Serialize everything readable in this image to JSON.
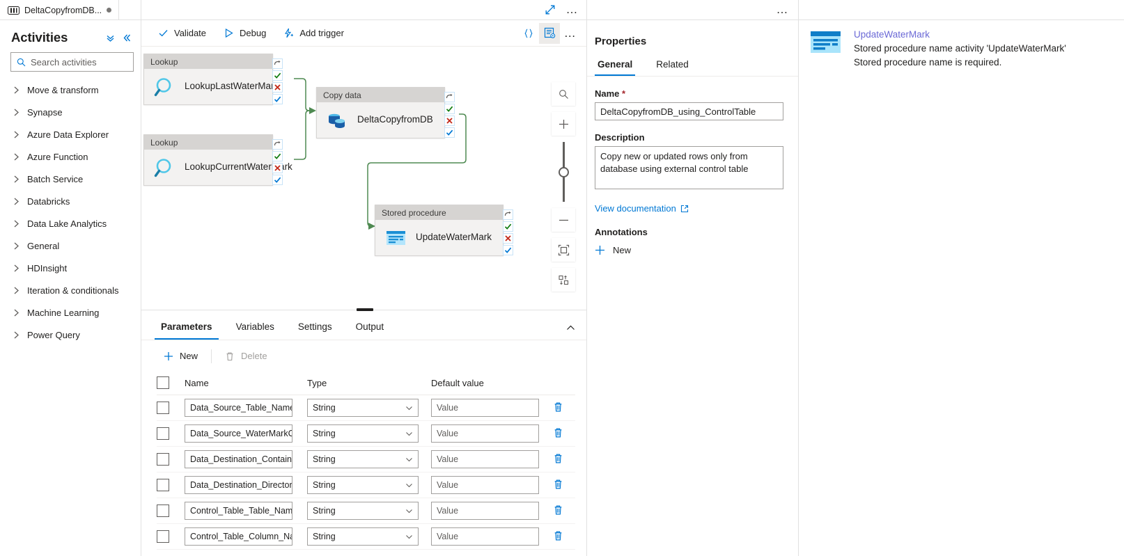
{
  "document_tab": {
    "title": "DeltaCopyfromDB...",
    "icon": "pipeline-icon",
    "dirty": true
  },
  "sidebar": {
    "title": "Activities",
    "collapse_all_icon": "double-chevron-down-icon",
    "collapse_pane_icon": "double-chevron-left-icon",
    "search": {
      "placeholder": "Search activities",
      "value": "",
      "icon": "search-icon"
    },
    "items": [
      {
        "label": "Move & transform"
      },
      {
        "label": "Synapse"
      },
      {
        "label": "Azure Data Explorer"
      },
      {
        "label": "Azure Function"
      },
      {
        "label": "Batch Service"
      },
      {
        "label": "Databricks"
      },
      {
        "label": "Data Lake Analytics"
      },
      {
        "label": "General"
      },
      {
        "label": "HDInsight"
      },
      {
        "label": "Iteration & conditionals"
      },
      {
        "label": "Machine Learning"
      },
      {
        "label": "Power Query"
      }
    ]
  },
  "canvas_header": {
    "expand_icon": "expand-diagonal-icon",
    "more_icon": "ellipsis-icon"
  },
  "toolbar": {
    "validate_label": "Validate",
    "debug_label": "Debug",
    "add_trigger_label": "Add trigger",
    "code_icon": "curly-braces-icon",
    "properties_icon": "properties-panel-icon",
    "more_icon": "ellipsis-icon"
  },
  "canvas": {
    "nodes": [
      {
        "type": "Lookup",
        "name": "LookupLastWaterMark",
        "icon": "magnifier-icon"
      },
      {
        "type": "Lookup",
        "name": "LookupCurrentWaterMark",
        "icon": "magnifier-icon"
      },
      {
        "type": "Copy data",
        "name": "DeltaCopyfromDB",
        "icon": "database-copy-icon"
      },
      {
        "type": "Stored procedure",
        "name": "UpdateWaterMark",
        "icon": "stored-procedure-icon"
      }
    ],
    "port_labels": [
      "on skip",
      "on success",
      "on failure",
      "on completion"
    ],
    "zoom_controls": [
      {
        "name": "search-canvas",
        "icon": "magnifier-icon"
      },
      {
        "name": "zoom-in",
        "icon": "plus-icon"
      },
      {
        "name": "zoom-slider",
        "icon": "slider"
      },
      {
        "name": "zoom-out",
        "icon": "minus-icon"
      },
      {
        "name": "zoom-to-fit",
        "icon": "fit-to-screen-icon"
      },
      {
        "name": "auto-align",
        "icon": "auto-align-icon"
      }
    ]
  },
  "dock": {
    "tabs": [
      {
        "label": "Parameters",
        "active": true
      },
      {
        "label": "Variables",
        "active": false
      },
      {
        "label": "Settings",
        "active": false
      },
      {
        "label": "Output",
        "active": false
      }
    ],
    "collapse_icon": "chevron-up-icon",
    "commands": {
      "new_label": "New",
      "new_icon": "plus-icon",
      "delete_label": "Delete",
      "delete_icon": "trash-icon",
      "delete_disabled": true
    },
    "table": {
      "headers": [
        "Name",
        "Type",
        "Default value"
      ],
      "default_value_placeholder": "Value",
      "delete_row_icon": "trash-icon",
      "rows": [
        {
          "name": "Data_Source_Table_Name",
          "type": "String",
          "default": ""
        },
        {
          "name": "Data_Source_WaterMarkColumn",
          "type": "String",
          "default": ""
        },
        {
          "name": "Data_Destination_Container",
          "type": "String",
          "default": ""
        },
        {
          "name": "Data_Destination_Directory",
          "type": "String",
          "default": ""
        },
        {
          "name": "Control_Table_Table_Name",
          "type": "String",
          "default": ""
        },
        {
          "name": "Control_Table_Column_Name",
          "type": "String",
          "default": ""
        }
      ]
    }
  },
  "properties": {
    "heading": "Properties",
    "more_icon": "ellipsis-icon",
    "tabs": [
      {
        "label": "General",
        "active": true
      },
      {
        "label": "Related",
        "active": false
      }
    ],
    "name_label": "Name",
    "name_required_mark": "*",
    "name_value": "DeltaCopyfromDB_using_ControlTable",
    "description_label": "Description",
    "description_value": "Copy new or updated rows only from database using external control table",
    "doc_link_label": "View documentation",
    "doc_link_icon": "external-link-icon",
    "annotations_label": "Annotations",
    "annotation_new_label": "New",
    "annotation_new_icon": "plus-icon"
  },
  "validation": {
    "item_title": "UpdateWaterMark",
    "item_icon": "stored-procedure-icon",
    "message_line1": "Stored procedure name activity 'UpdateWaterMark'",
    "message_line2": "Stored procedure name is required."
  },
  "colors": {
    "accent": "#0078d4",
    "link_purple": "#6b69d6",
    "success_green": "#107c10",
    "failure_red": "#c42b1c",
    "connector_green": "#4f8a52",
    "node_header": "#d6d4d2",
    "node_body": "#f3f2f1"
  }
}
